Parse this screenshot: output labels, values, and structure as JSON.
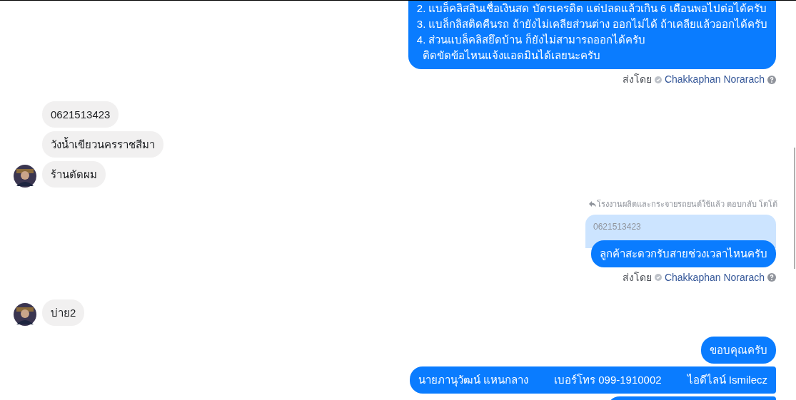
{
  "messages": [
    {
      "kind": "outgoing",
      "lines": [
        "2. แบล็คลิสสินเชื่อเงินสด บัตรเครดิต แต่ปลดแล้วเกิน 6 เดือนพอไปต่อได้ครับ",
        "3. แบล็กลิสติดคืนรถ ถ้ายังไม่เคลียส่วนต่าง ออกไม่ได้ ถ้าเคลียแล้วออกได้ครับ",
        "4. ส่วนแบล็คลิสยึดบ้าน ก็ยังไม่สามารถออกได้ครับ",
        "  ติดขัดข้อไหนแจ้งแอดมินได้เลยนะครับ"
      ]
    },
    {
      "kind": "sent_by",
      "label": "ส่งโดย",
      "name": "Chakkaphan Norarach"
    },
    {
      "kind": "incoming",
      "lines": [
        "0621513423",
        "วังน้ำเขียวนครราชสีมา",
        "ร้านตัดผม"
      ]
    },
    {
      "kind": "reply",
      "context": "โรงงานผลิตและกระจายรถยนต์ใช้แล้ว ตอบกลับ โตโต้",
      "quoted": "0621513423",
      "text": "ลูกค้าสะดวกรับสายช่วงเวลาไหนครับ"
    },
    {
      "kind": "sent_by",
      "label": "ส่งโดย",
      "name": "Chakkaphan Norarach"
    },
    {
      "kind": "incoming",
      "lines": [
        "บ่าย2"
      ]
    },
    {
      "kind": "outgoing",
      "lines": [
        "ขอบคุณครับ"
      ]
    },
    {
      "kind": "outgoing_columns",
      "columns": [
        "นายภานุวัฒน์ แหนกลาง",
        "เบอร์โทร 099-1910002",
        "ไอดีไลน์ Ismilecz"
      ]
    },
    {
      "kind": "outgoing_cut"
    }
  ]
}
